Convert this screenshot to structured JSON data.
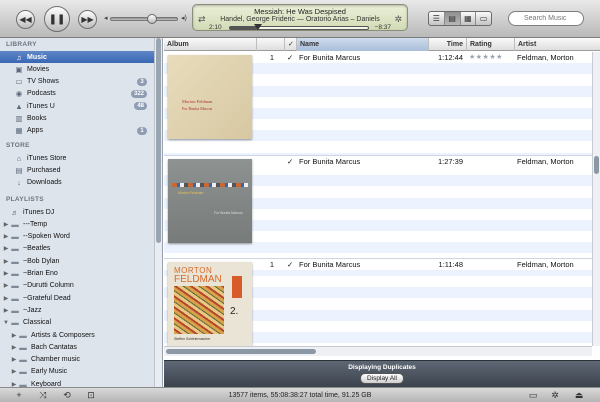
{
  "toolbar": {
    "now_playing": {
      "title": "Messiah: He Was Despised",
      "artist_line": "Handel, George Frideric — Oratorio Arias – Daniels",
      "elapsed": "2:10",
      "remaining": "−8:37",
      "progress": 0.2
    },
    "volume": 0.62,
    "search_placeholder": "Search Music"
  },
  "sidebar": {
    "library_heading": "LIBRARY",
    "library": [
      {
        "label": "Music",
        "icon": "music-note-icon",
        "selected": true,
        "badge": ""
      },
      {
        "label": "Movies",
        "icon": "film-icon",
        "badge": ""
      },
      {
        "label": "TV Shows",
        "icon": "tv-icon",
        "badge": "3"
      },
      {
        "label": "Podcasts",
        "icon": "podcast-icon",
        "badge": "322"
      },
      {
        "label": "iTunes U",
        "icon": "itunes-u-icon",
        "badge": "48"
      },
      {
        "label": "Books",
        "icon": "book-icon",
        "badge": ""
      },
      {
        "label": "Apps",
        "icon": "apps-icon",
        "badge": "1"
      }
    ],
    "store_heading": "STORE",
    "store": [
      {
        "label": "iTunes Store",
        "icon": "store-icon"
      },
      {
        "label": "Purchased",
        "icon": "purchased-icon"
      },
      {
        "label": "Downloads",
        "icon": "download-icon"
      }
    ],
    "playlists_heading": "PLAYLISTS",
    "playlists": [
      {
        "label": "iTunes DJ",
        "icon": "dj-icon",
        "folder": false,
        "open": false,
        "indent": 0
      },
      {
        "label": "---Temp",
        "icon": "folder-icon",
        "folder": true,
        "open": false,
        "indent": 0
      },
      {
        "label": "--Spoken Word",
        "icon": "folder-icon",
        "folder": true,
        "open": false,
        "indent": 0
      },
      {
        "label": "~Beatles",
        "icon": "folder-icon",
        "folder": true,
        "open": false,
        "indent": 0
      },
      {
        "label": "~Bob Dylan",
        "icon": "folder-icon",
        "folder": true,
        "open": false,
        "indent": 0
      },
      {
        "label": "~Brian Eno",
        "icon": "folder-icon",
        "folder": true,
        "open": false,
        "indent": 0
      },
      {
        "label": "~Durutti Column",
        "icon": "folder-icon",
        "folder": true,
        "open": false,
        "indent": 0
      },
      {
        "label": "~Grateful Dead",
        "icon": "folder-icon",
        "folder": true,
        "open": false,
        "indent": 0
      },
      {
        "label": "~Jazz",
        "icon": "folder-icon",
        "folder": true,
        "open": false,
        "indent": 0
      },
      {
        "label": "Classical",
        "icon": "folder-icon",
        "folder": true,
        "open": true,
        "indent": 0
      },
      {
        "label": "Artists & Composers",
        "icon": "folder-icon",
        "folder": true,
        "open": false,
        "indent": 1
      },
      {
        "label": "Bach Cantatas",
        "icon": "folder-icon",
        "folder": true,
        "open": false,
        "indent": 1
      },
      {
        "label": "Chamber music",
        "icon": "folder-icon",
        "folder": true,
        "open": false,
        "indent": 1
      },
      {
        "label": "Early Music",
        "icon": "folder-icon",
        "folder": true,
        "open": false,
        "indent": 1
      },
      {
        "label": "Keyboard",
        "icon": "folder-icon",
        "folder": true,
        "open": false,
        "indent": 1
      }
    ]
  },
  "columns": {
    "album": "Album",
    "check": "✓",
    "name": "Name",
    "time": "Time",
    "rating": "Rating",
    "artist": "Artist"
  },
  "tracks": [
    {
      "number": "1",
      "checked": "✓",
      "name": "For Bunita Marcus",
      "time": "1:12:44",
      "rating": 5,
      "artist": "Feldman, Morton"
    },
    {
      "number": "",
      "checked": "✓",
      "name": "For Bunita Marcus",
      "time": "1:27:39",
      "rating": 0,
      "artist": "Feldman, Morton"
    },
    {
      "number": "1",
      "checked": "✓",
      "name": "For Bunita Marcus",
      "time": "1:11:48",
      "rating": 0,
      "artist": "Feldman, Morton"
    }
  ],
  "album_art": [
    {
      "line1": "Morton Feldman",
      "line2": "For Bunita Marcus"
    },
    {
      "line1": "Morton Feldman",
      "line2": "For Bunita Marcus"
    },
    {
      "line1": "MORTON",
      "line2": "FELDMAN",
      "line3": "2.",
      "line4": "Steffen Schleiermacher"
    }
  ],
  "duplicates": {
    "label": "Displaying Duplicates",
    "button": "Display All"
  },
  "status": {
    "text": "13577 items, 55:08:38:27 total time, 91.25 GB"
  },
  "colors": {
    "selection": "#3a66b4",
    "sidebar_bg": "#dde4ec",
    "lcd_bg": "#dfe6c6"
  }
}
